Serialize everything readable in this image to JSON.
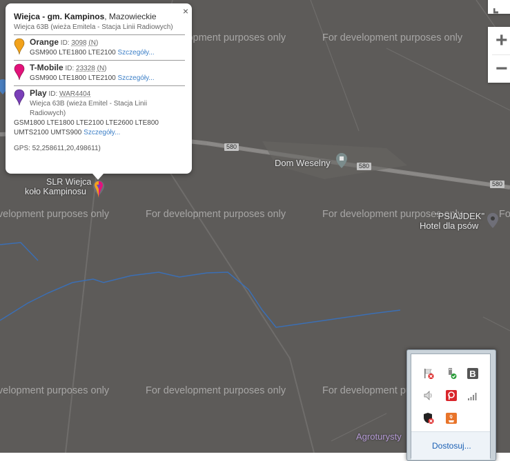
{
  "map": {
    "watermark_text": "For development purposes only",
    "labels": {
      "dom_weselny": "Dom Weselny",
      "slr_line1": "SLR Wiejca",
      "slr_line2": "koło Kampinosu",
      "hotel_line1": "\"PSIAJDEK\"",
      "hotel_line2": "Hotel dla psów",
      "agro": "Agroturysty"
    },
    "road_number": "580",
    "colors": {
      "background": "#5d5b59",
      "road": "#7a7876",
      "water": "#3b6fb5"
    }
  },
  "zoom": {
    "in_label": "+",
    "out_label": "−"
  },
  "popup": {
    "title_bold": "Wiejca - gm. Kampinos",
    "title_rest": ", Mazowieckie",
    "subtitle": "Wiejca 63B (wieża Emitela - Stacja Linii Radiowych)",
    "close_label": "×",
    "operators": [
      {
        "name": "Orange",
        "id_label": "ID:",
        "id": "3098",
        "flag": "(N)",
        "bands": "GSM900 LTE1800 LTE2100",
        "link": "Szczegóły...",
        "color": "#f2a21b"
      },
      {
        "name": "T-Mobile",
        "id_label": "ID:",
        "id": "23328",
        "flag": "(N)",
        "bands": "GSM900 LTE1800 LTE2100",
        "link": "Szczegóły...",
        "color": "#e2127a"
      },
      {
        "name": "Play",
        "id_label": "ID:",
        "id": "WAR4404",
        "note": "Wiejca 63B (wieża Emitel - Stacja Linii Radiowych)",
        "bands": "GSM1800 LTE1800 LTE2100 LTE2600 LTE800 UMTS2100 UMTS900",
        "link": "Szczegóły...",
        "color": "#7a3fb8"
      }
    ],
    "gps": "GPS: 52,258611,20,498611)"
  },
  "tray": {
    "customize_label": "Dostosuj...",
    "icons": [
      "flag-error-icon",
      "usb-check-icon",
      "b-app-icon",
      "speaker-icon",
      "red-p-app-icon",
      "signal-bars-icon",
      "shield-error-icon",
      "java-icon"
    ]
  }
}
